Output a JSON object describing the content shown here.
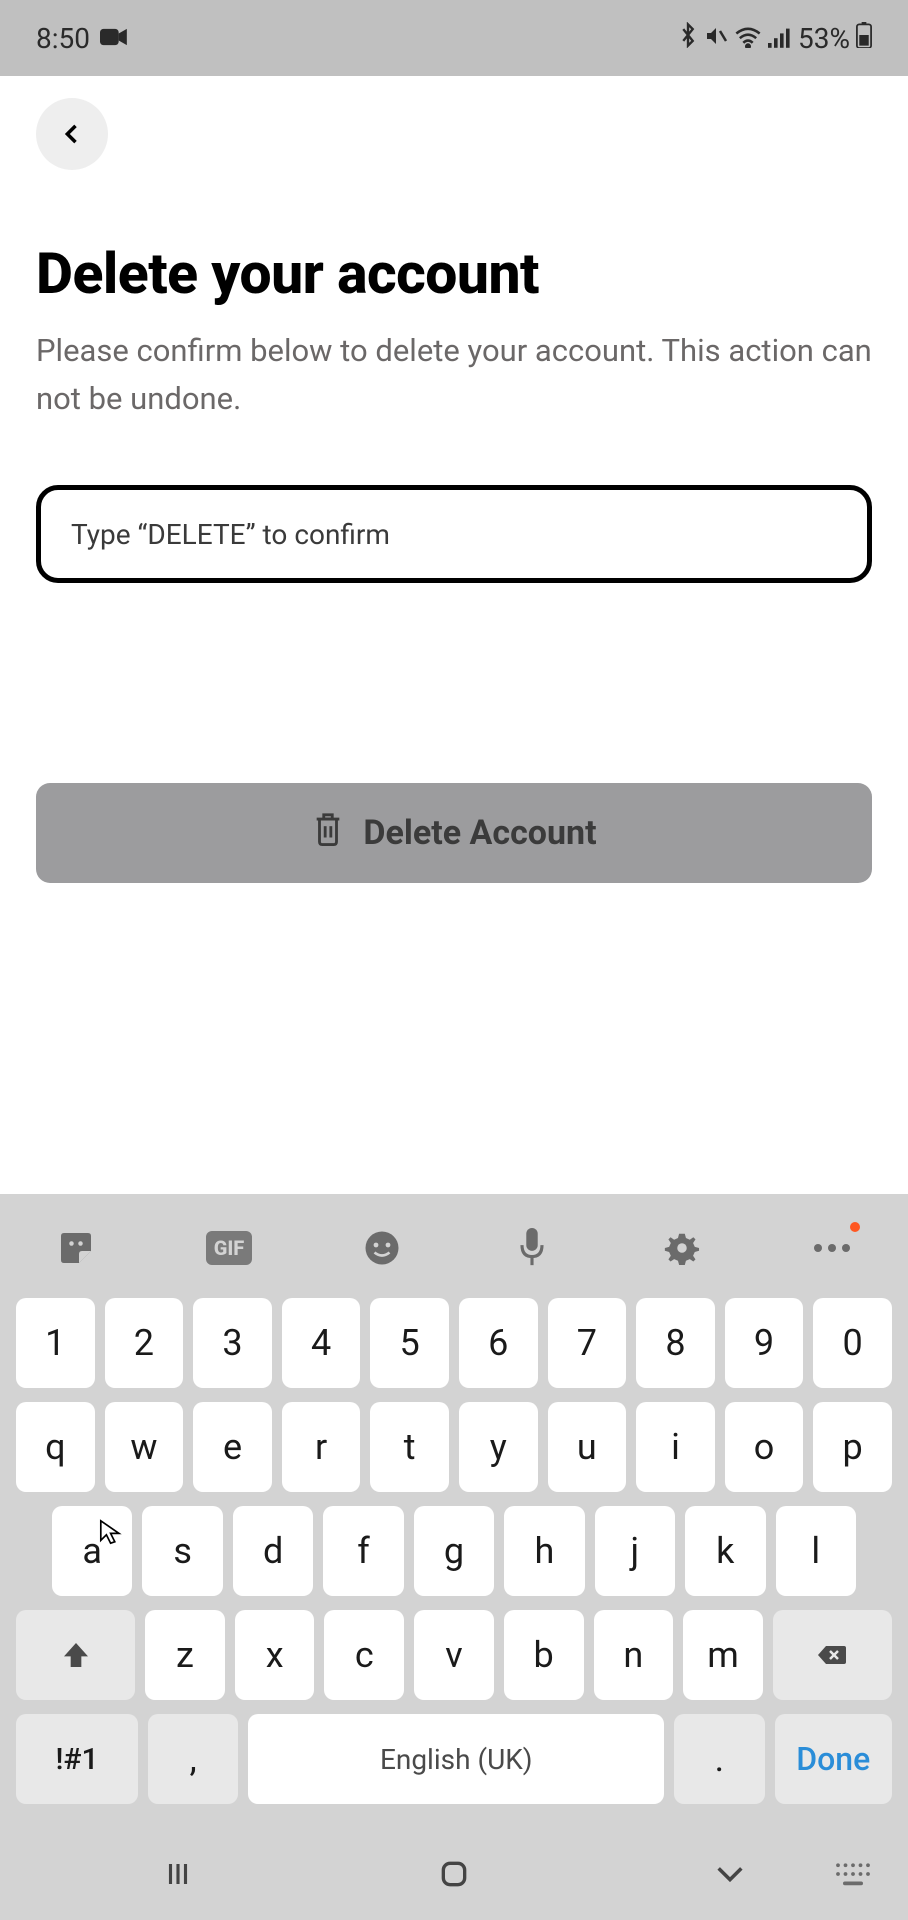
{
  "status": {
    "time": "8:50",
    "battery_pct": "53%"
  },
  "page": {
    "title": "Delete your account",
    "subtitle": "Please confirm below to delete your account. This action can not be undone.",
    "input_placeholder": "Type “DELETE” to confirm",
    "button_label": "Delete Account"
  },
  "keyboard": {
    "row_num": [
      "1",
      "2",
      "3",
      "4",
      "5",
      "6",
      "7",
      "8",
      "9",
      "0"
    ],
    "row_q": [
      "q",
      "w",
      "e",
      "r",
      "t",
      "y",
      "u",
      "i",
      "o",
      "p"
    ],
    "row_a": [
      "a",
      "s",
      "d",
      "f",
      "g",
      "h",
      "j",
      "k",
      "l"
    ],
    "row_z": [
      "z",
      "x",
      "c",
      "v",
      "b",
      "n",
      "m"
    ],
    "symbols": "!#1",
    "comma": ",",
    "space": "English (UK)",
    "period": ".",
    "done": "Done"
  }
}
